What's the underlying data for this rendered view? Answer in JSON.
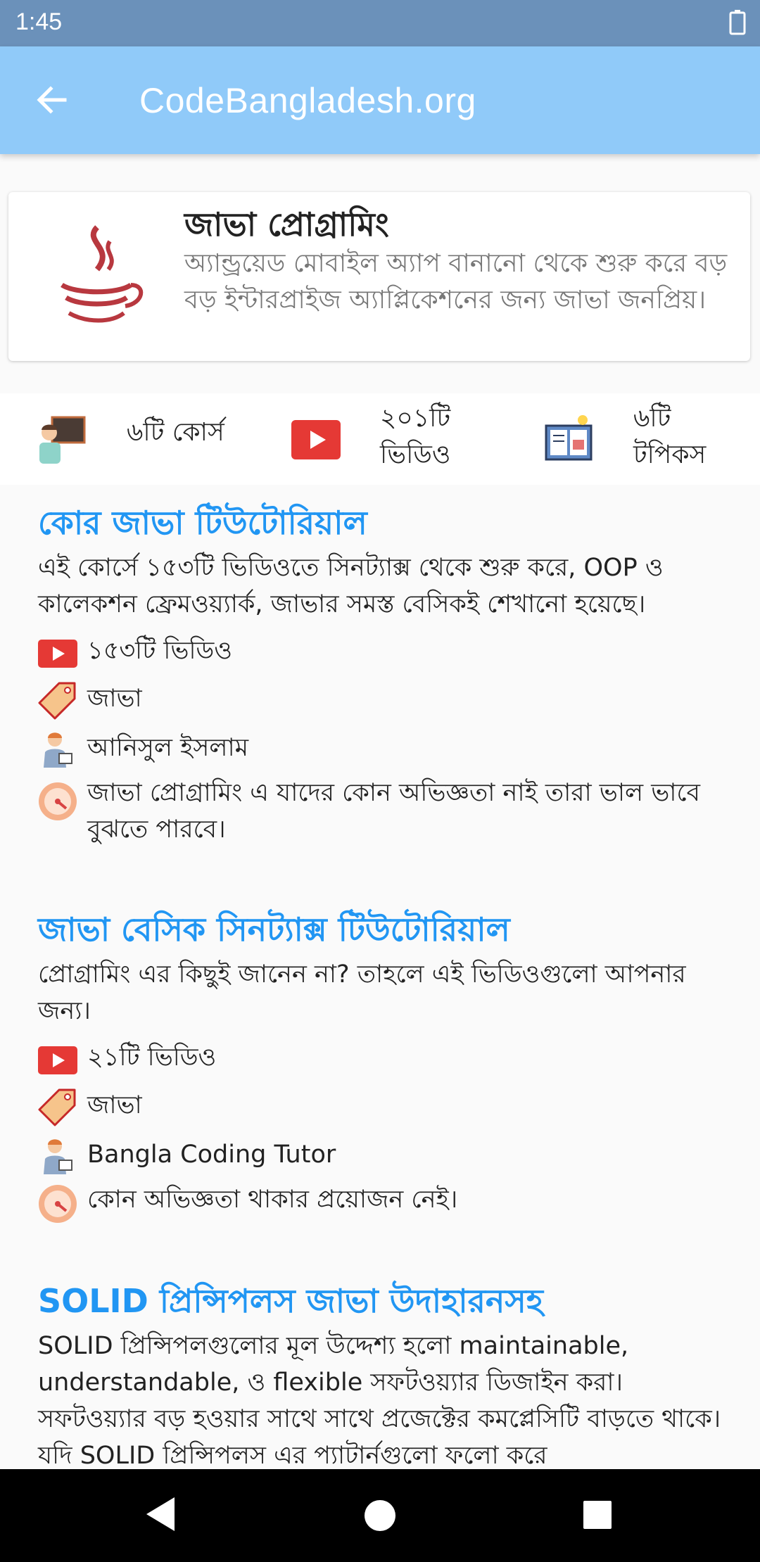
{
  "status_bar": {
    "time": "1:45"
  },
  "app_bar": {
    "title": "CodeBangladesh.org"
  },
  "header_card": {
    "title": "জাভা প্রোগ্রামিং",
    "description": "অ্যান্ড্রয়েড মোবাইল অ্যাপ বানানো থেকে শুরু করে বড় বড় ইন্টারপ্রাইজ অ্যাপ্লিকেশনের জন্য জাভা জনপ্রিয়।"
  },
  "stats": [
    {
      "icon": "teacher-icon",
      "label": "৬টি কোর্স"
    },
    {
      "icon": "youtube-icon",
      "label_line1": "২০১টি",
      "label_line2": "ভিডিও"
    },
    {
      "icon": "book-idea-icon",
      "label_line1": "৬টি",
      "label_line2": "টপিকস"
    }
  ],
  "courses": [
    {
      "title": "কোর জাভা টিউটোরিয়াল",
      "description": "এই কোর্সে ১৫৩টি ভিডিওতে সিনট্যাক্স থেকে শুরু করে, OOP ও কালেকশন ফ্রেমওয়্যার্ক, জাভার সমস্ত বেসিকই শেখানো হয়েছে।",
      "videos": " ১৫৩টি ভিডিও",
      "tag": "জাভা",
      "instructor": "আনিসুল ইসলাম",
      "level": "জাভা প্রোগ্রামিং এ যাদের কোন অভিজ্ঞতা নাই তারা ভাল ভাবে বুঝতে পারবে।"
    },
    {
      "title": "জাভা বেসিক সিনট্যাক্স টিউটোরিয়াল",
      "description": "প্রোগ্রামিং এর কিছুই জানেন না? তাহলে এই ভিডিওগুলো আপনার জন্য।",
      "videos": " ২১টি ভিডিও",
      "tag": "জাভা",
      "instructor": "Bangla Coding Tutor",
      "level": "কোন অভিজ্ঞতা থাকার প্রয়োজন নেই।"
    },
    {
      "title": "SOLID প্রিন্সিপলস জাভা উদাহারনসহ",
      "description": "SOLID প্রিন্সিপলগুলোর মূল উদ্দেশ্য হলো maintainable, understandable, ও flexible সফটওয়্যার ডিজাইন করা। সফটওয়্যার বড় হওয়ার সাথে সাথে প্রজেক্টের কমপ্লেসিটি বাড়তে থাকে। যদি SOLID প্রিন্সিপলস এর প্যাটার্নগুলো ফলো করে"
    }
  ],
  "colors": {
    "status_bar": "#6b91ba",
    "app_bar": "#90caf9",
    "course_title": "#2196f3",
    "youtube_red": "#e53935",
    "nav_bar": "#000000"
  }
}
